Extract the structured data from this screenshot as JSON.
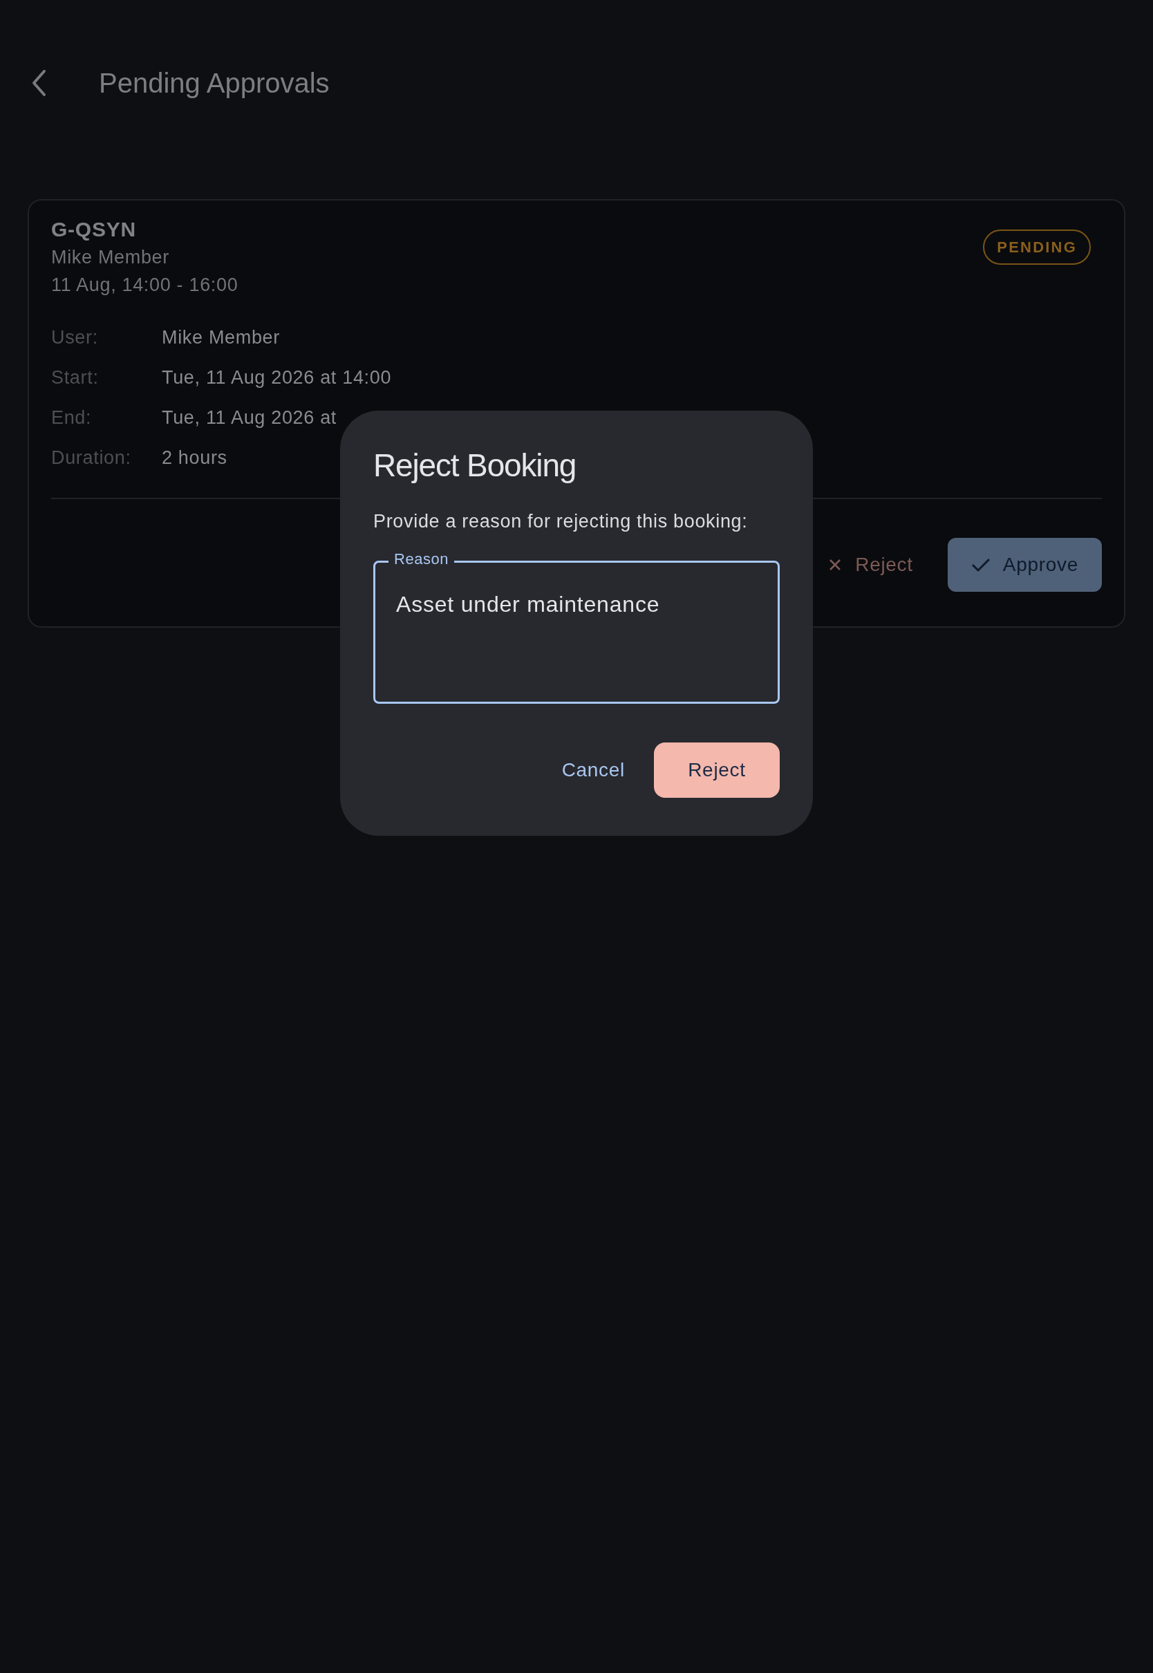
{
  "header": {
    "title": "Pending Approvals"
  },
  "booking": {
    "asset": "G-QSYN",
    "member": "Mike Member",
    "slot": "11 Aug, 14:00 - 16:00",
    "status": "PENDING",
    "details": [
      {
        "label": "User:",
        "value": "Mike Member"
      },
      {
        "label": "Start:",
        "value": "Tue, 11 Aug 2026 at 14:00"
      },
      {
        "label": "End:",
        "value": "Tue, 11 Aug 2026 at"
      },
      {
        "label": "Duration:",
        "value": "2 hours"
      }
    ],
    "actions": [
      {
        "label": "Reject",
        "kind": "text"
      },
      {
        "label": "Approve",
        "kind": "filled"
      }
    ]
  },
  "dialog": {
    "title": "Reject Booking",
    "message": "Provide a reason for rejecting this booking:",
    "field": {
      "label": "Reason",
      "value": "Asset under maintenance",
      "focused": true
    },
    "buttons": [
      {
        "label": "Cancel",
        "kind": "text"
      },
      {
        "label": "Reject",
        "kind": "filled"
      }
    ]
  }
}
